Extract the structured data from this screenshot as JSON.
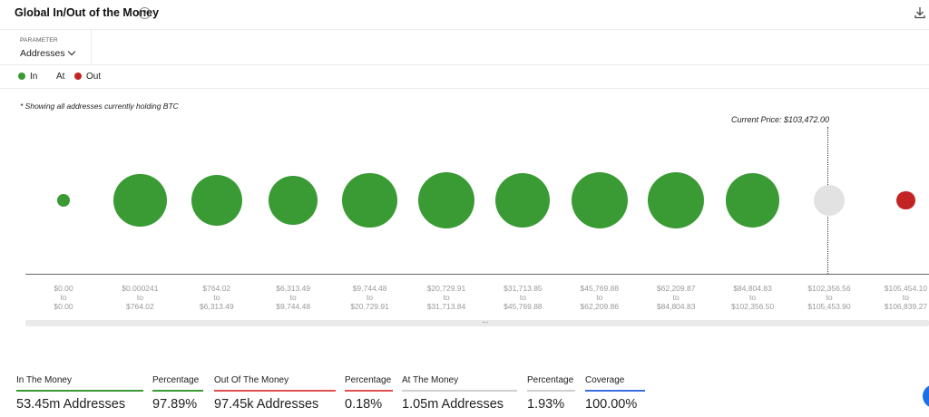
{
  "header": {
    "title": "Global In/Out of the Money",
    "info_icon": "info-icon",
    "download_icon": "download-icon"
  },
  "parameter": {
    "label": "PARAMETER",
    "value": "Addresses"
  },
  "legend": [
    {
      "label": "In",
      "color": "#3a9b35"
    },
    {
      "label": "At",
      "color": ""
    },
    {
      "label": "Out",
      "color": "#c22424"
    }
  ],
  "note": "* Showing all addresses currently holding BTC",
  "current_price": "Current Price: $103,472.00",
  "colors": {
    "in": "#3a9b35",
    "at": "#e2e2e2",
    "out": "#c22424",
    "coverage": "#3b6fe0"
  },
  "chart_data": {
    "type": "bubble",
    "x_labels": [
      "$0.00 to $0.00",
      "$0.000241 to $764.02",
      "$764.02 to $6,313.49",
      "$6,313.49 to $9,744.48",
      "$9,744.48 to $20,729.91",
      "$20,729.91 to $31,713.84",
      "$31,713.85 to $45,769.88",
      "$45,769.88 to $62,209.86",
      "$62,209.87 to $84,804.83",
      "$84,804.83 to $102,356.50",
      "$102,356.56 to $105,453.90",
      "$105,454.10 to $106,839.27"
    ],
    "ticks": [
      [
        "$0.00",
        "to",
        "$0.00"
      ],
      [
        "$0.000241",
        "to",
        "$764.02"
      ],
      [
        "$764.02",
        "to",
        "$6,313.49"
      ],
      [
        "$6,313.49",
        "to",
        "$9,744.48"
      ],
      [
        "$9,744.48",
        "to",
        "$20,729.91"
      ],
      [
        "$20,729.91",
        "to",
        "$31,713.84"
      ],
      [
        "$31,713.85",
        "to",
        "$45,769.88"
      ],
      [
        "$45,769.88",
        "to",
        "$62,209.86"
      ],
      [
        "$62,209.87",
        "to",
        "$84,804.83"
      ],
      [
        "$84,804.83",
        "to",
        "$102,356.50"
      ],
      [
        "$102,356.56",
        "to",
        "$105,453.90"
      ],
      [
        "$105,454.10",
        "to",
        "$106,839.27"
      ]
    ],
    "status": [
      "in",
      "in",
      "in",
      "in",
      "in",
      "in",
      "in",
      "in",
      "in",
      "in",
      "at",
      "out"
    ],
    "relative_size": [
      0.23,
      0.95,
      0.9,
      0.87,
      0.98,
      1.0,
      0.97,
      1.0,
      1.0,
      0.96,
      0.55,
      0.33
    ]
  },
  "stats": [
    {
      "label": "In The Money",
      "value": "53.45m Addresses",
      "bar": "#3a9b35"
    },
    {
      "label": "Percentage",
      "value": "97.89%",
      "bar": "#3a9b35"
    },
    {
      "label": "Out Of The Money",
      "value": "97.45k Addresses",
      "bar": "#e05050"
    },
    {
      "label": "Percentage",
      "value": "0.18%",
      "bar": "#e05050"
    },
    {
      "label": "At The Money",
      "value": "1.05m Addresses",
      "bar": "#cfcfcf"
    },
    {
      "label": "Percentage",
      "value": "1.93%",
      "bar": "#cfcfcf"
    },
    {
      "label": "Coverage",
      "value": "100.00%",
      "bar": "#3b6fe0"
    }
  ]
}
